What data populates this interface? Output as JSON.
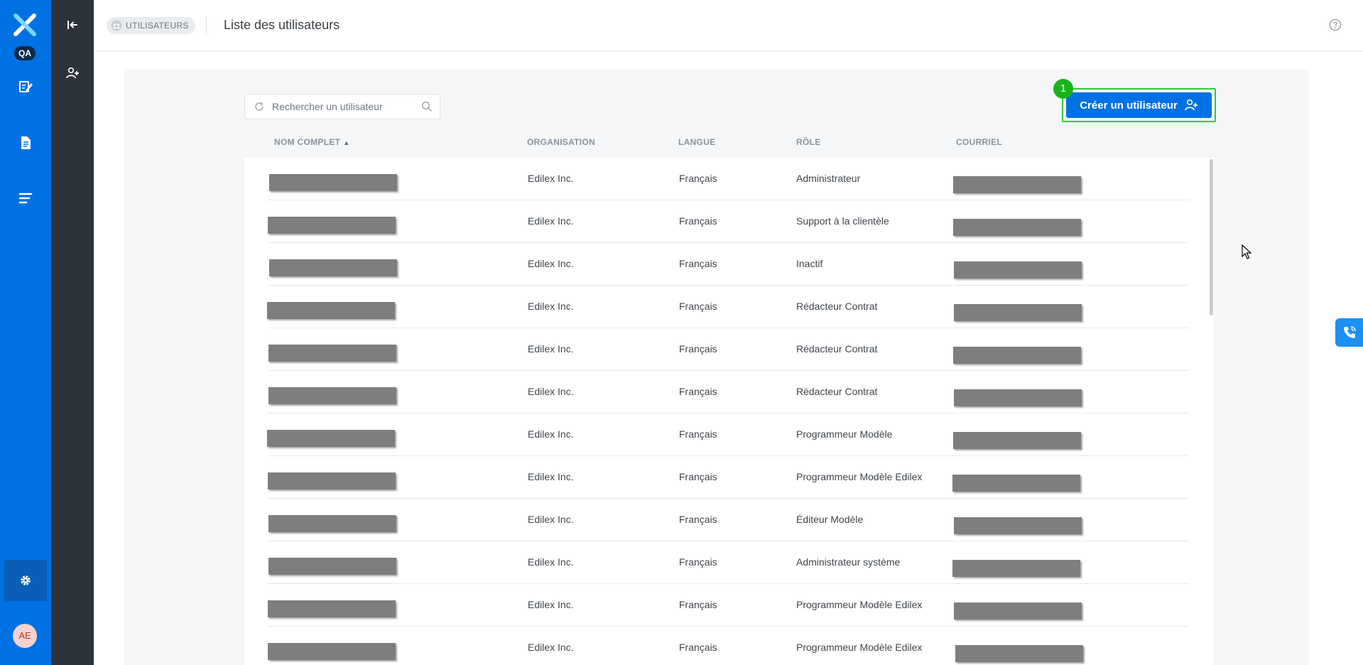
{
  "app": {
    "env_badge": "QA",
    "avatar_initials": "AE",
    "brand_color": "#0071e3"
  },
  "rail": {
    "items": [
      {
        "icon": "edit-document-icon"
      },
      {
        "icon": "document-icon"
      },
      {
        "icon": "list-icon"
      }
    ],
    "settings_icon": "gear-icon"
  },
  "subbar": {
    "collapse_icon": "collapse-left-icon",
    "add_user_icon": "add-user-icon"
  },
  "header": {
    "section_label": "UTILISATEURS",
    "page_title": "Liste des utilisateurs",
    "help_icon": "help-circle-icon"
  },
  "search": {
    "placeholder": "Rechercher un utilisateur"
  },
  "create_button": {
    "label": "Créer un utilisateur",
    "step_badge": "1"
  },
  "table": {
    "columns": {
      "full_name": "NOM COMPLET",
      "organization": "ORGANISATION",
      "language": "LANGUE",
      "role": "RÔLE",
      "email": "COURRIEL"
    },
    "sort_indicator": "▲",
    "rows": [
      {
        "organization": "Edilex Inc.",
        "language": "Français",
        "role": "Administrateur"
      },
      {
        "organization": "Edilex Inc.",
        "language": "Français",
        "role": "Support à la clientèle"
      },
      {
        "organization": "Edilex Inc.",
        "language": "Français",
        "role": "Inactif"
      },
      {
        "organization": "Edilex Inc.",
        "language": "Français",
        "role": "Rédacteur Contrat"
      },
      {
        "organization": "Edilex Inc.",
        "language": "Français",
        "role": "Rédacteur Contrat"
      },
      {
        "organization": "Edilex Inc.",
        "language": "Français",
        "role": "Rédacteur Contrat"
      },
      {
        "organization": "Edilex Inc.",
        "language": "Français",
        "role": "Programmeur Modèle"
      },
      {
        "organization": "Edilex Inc.",
        "language": "Français",
        "role": "Programmeur Modèle Edilex"
      },
      {
        "organization": "Edilex Inc.",
        "language": "Français",
        "role": "Éditeur Modèle"
      },
      {
        "organization": "Edilex Inc.",
        "language": "Français",
        "role": "Administrateur système"
      },
      {
        "organization": "Edilex Inc.",
        "language": "Français",
        "role": "Programmeur Modèle Edilex"
      },
      {
        "organization": "Edilex Inc.",
        "language": "Français",
        "role": "Programmeur Modèle Edilex"
      }
    ]
  },
  "phone_tab": {
    "icon": "phone-icon"
  }
}
